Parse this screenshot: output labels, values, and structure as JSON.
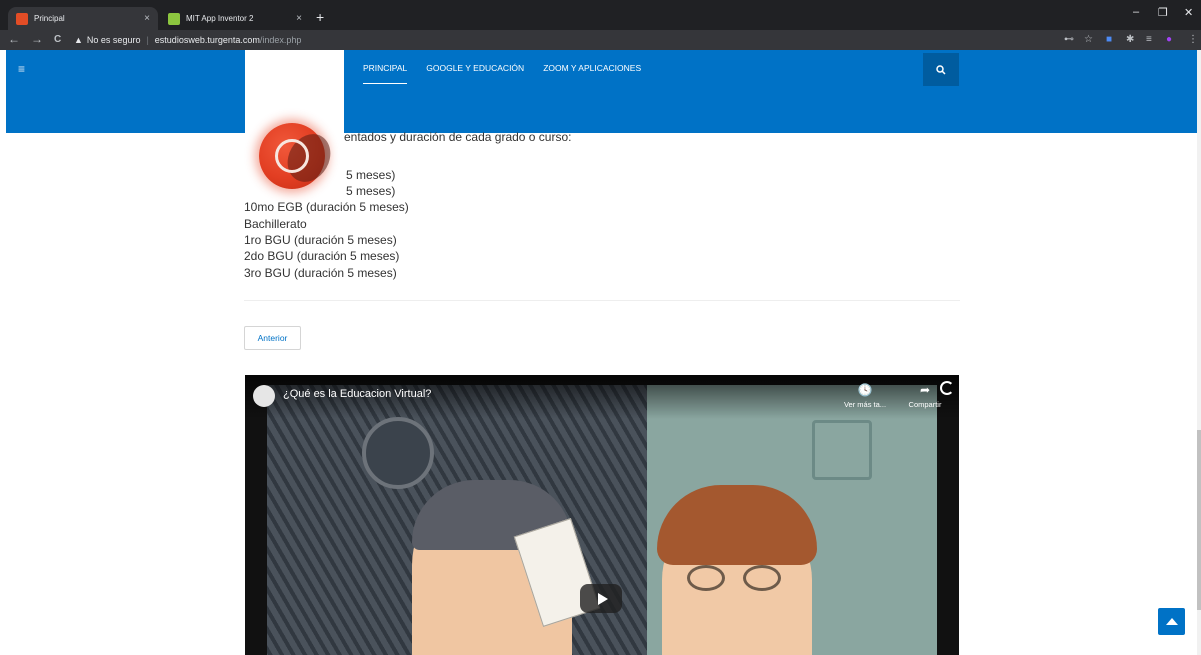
{
  "browser": {
    "tabs": [
      {
        "title": "Principal",
        "close": "×",
        "favicon_color": "#e34d26"
      },
      {
        "title": "MIT App Inventor 2",
        "close": "×",
        "favicon_color": "#8cc63f"
      }
    ],
    "new_tab": "+",
    "window_controls": {
      "minimize": "–",
      "maximize": "❐",
      "close": "✕"
    },
    "nav": {
      "back": "←",
      "forward": "→",
      "reload": "C"
    },
    "address": {
      "security_icon": "▲",
      "security_text": "No es seguro",
      "separator": "|",
      "host": "estudiosweb.turgenta.com",
      "path": "/index.php"
    },
    "extensions": [
      "key-icon",
      "star-icon",
      "zoom-icon",
      "puzzle-icon",
      "reading-list-icon",
      "profile-icon",
      "menu-icon"
    ]
  },
  "site": {
    "menu_icon": "≡",
    "nav": [
      {
        "label": "PRINCIPAL",
        "active": true
      },
      {
        "label": "GOOGLE Y EDUCACIÓN",
        "active": false
      },
      {
        "label": "ZOOM Y APLICACIONES",
        "active": false
      }
    ],
    "search_icon": "🔍",
    "brand_color": "#0072c6"
  },
  "content": {
    "lines": [
      "entados y duración de cada grado o curso:",
      "5 meses)",
      "5 meses)",
      "10mo EGB (duración 5 meses)",
      "Bachillerato",
      "1ro BGU (duración 5 meses)",
      "2do BGU (duración 5 meses)",
      "3ro BGU (duración 5 meses)"
    ],
    "prev_button": "Anterior"
  },
  "video": {
    "title": "¿Qué es la Educacion Virtual?",
    "watch_later": "Ver más ta...",
    "share": "Compartir"
  }
}
